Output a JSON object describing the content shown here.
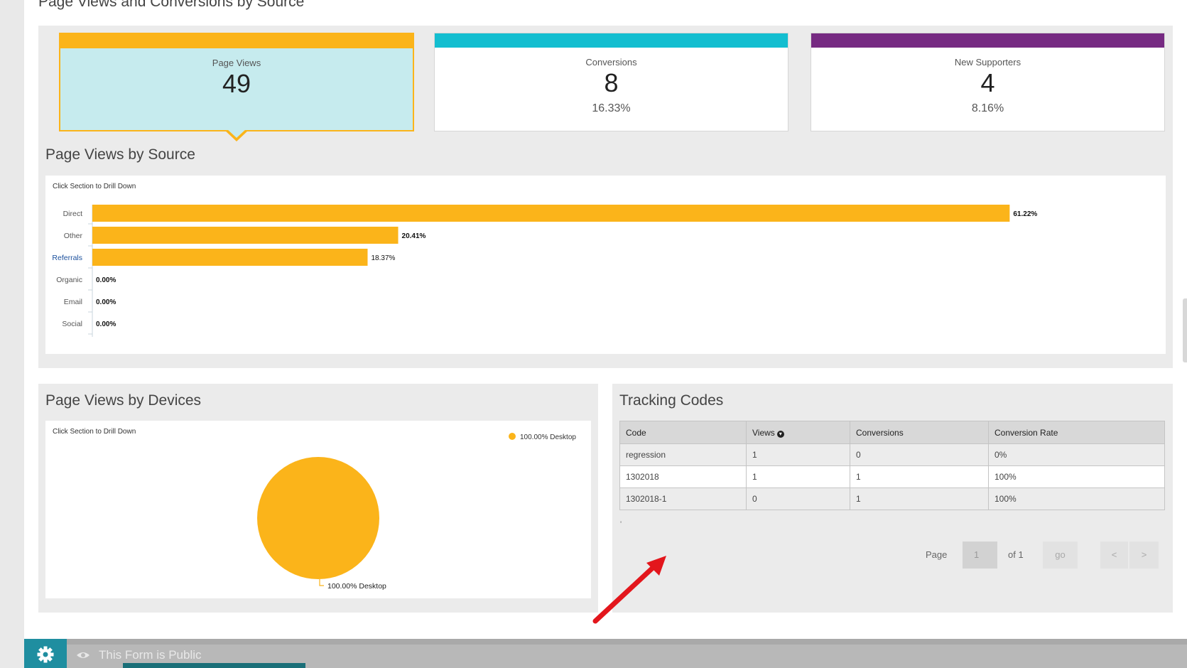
{
  "page": {
    "title": "Page Views and Conversions by Source"
  },
  "stats": [
    {
      "label": "Page Views",
      "value": "49",
      "pct": "",
      "color": "#fbb41a",
      "active": true
    },
    {
      "label": "Conversions",
      "value": "8",
      "pct": "16.33%",
      "color": "#13bed0",
      "active": false
    },
    {
      "label": "New Supporters",
      "value": "4",
      "pct": "8.16%",
      "color": "#762a82",
      "active": false
    }
  ],
  "source_panel": {
    "title": "Page Views by Source",
    "hint": "Click Section to Drill Down"
  },
  "chart_data": [
    {
      "type": "bar",
      "orientation": "horizontal",
      "categories": [
        "Direct",
        "Other",
        "Referrals",
        "Organic",
        "Email",
        "Social"
      ],
      "values": [
        61.22,
        20.41,
        18.37,
        0.0,
        0.0,
        0.0
      ],
      "value_labels": [
        "61.22%",
        "20.41%",
        "18.37%",
        "0.00%",
        "0.00%",
        "0.00%"
      ],
      "xlim": [
        0,
        64
      ],
      "bar_color": "#fbb41a",
      "link_category": "Referrals"
    },
    {
      "type": "pie",
      "labels": [
        "Desktop"
      ],
      "values": [
        100.0
      ],
      "value_labels": [
        "100.00% Desktop"
      ],
      "legend": "top-right",
      "color": "#fbb41a"
    }
  ],
  "devices_panel": {
    "title": "Page Views by Devices",
    "hint": "Click Section to Drill Down",
    "legend_label": "100.00% Desktop",
    "slice_label": "100.00% Desktop"
  },
  "tracking": {
    "title": "Tracking Codes",
    "columns": [
      "Code",
      "Views",
      "Conversions",
      "Conversion Rate"
    ],
    "sort_icon": "sort-desc-circle-icon",
    "rows": [
      [
        "regression",
        "1",
        "0",
        "0%"
      ],
      [
        "1302018",
        "1",
        "1",
        "100%"
      ],
      [
        "1302018-1",
        "0",
        "1",
        "100%"
      ]
    ],
    "tick": "'",
    "pager": {
      "page_label": "Page",
      "page_value": "1",
      "of_label": "of 1",
      "go_label": "go",
      "prev_label": "<",
      "next_label": ">"
    }
  },
  "footer": {
    "settings_icon": "gear-icon",
    "visibility_icon": "eye-icon",
    "public_text": "This Form is Public"
  },
  "annotation": {
    "arrow_color": "#e3161c"
  }
}
